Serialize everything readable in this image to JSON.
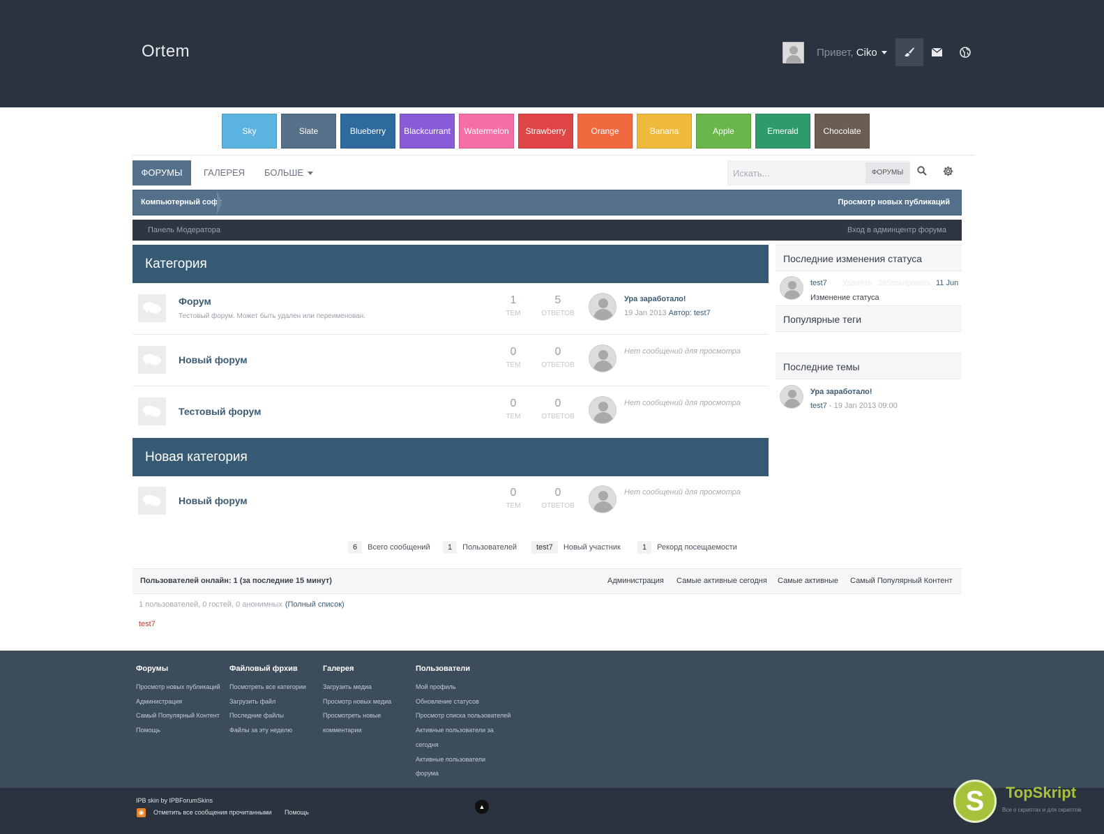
{
  "header": {
    "logo": "Ortem",
    "greeting": "Привет,",
    "username": "Ciko"
  },
  "swatches": [
    {
      "label": "Sky",
      "color": "#5bb4e0"
    },
    {
      "label": "Slate",
      "color": "#56708a"
    },
    {
      "label": "Blueberry",
      "color": "#2f6a9e"
    },
    {
      "label": "Blackcurrant",
      "color": "#8a5bd8"
    },
    {
      "label": "Watermelon",
      "color": "#f56fa6"
    },
    {
      "label": "Strawberry",
      "color": "#e04545"
    },
    {
      "label": "Orange",
      "color": "#f0693f"
    },
    {
      "label": "Banana",
      "color": "#f0bb3c"
    },
    {
      "label": "Apple",
      "color": "#6ab64a"
    },
    {
      "label": "Emerald",
      "color": "#2f9a6b"
    },
    {
      "label": "Chocolate",
      "color": "#6b5d52"
    }
  ],
  "nav": {
    "tabs": [
      "ФОРУМЫ",
      "ГАЛЕРЕЯ",
      "БОЛЬШЕ"
    ],
    "search_placeholder": "Искать...",
    "search_scope": "ФОРУМЫ"
  },
  "breadcrumb": {
    "item": "Компьютерный софт",
    "right": "Просмотр новых публикаций"
  },
  "modbar": {
    "left": "Панель Модератора",
    "right": "Вход в админцентр форума"
  },
  "categories": [
    {
      "title": "Категория",
      "forums": [
        {
          "name": "Форум",
          "desc": "Тестовый форум. Может быть удален или переименован.",
          "topics": "1",
          "replies": "5",
          "topics_label": "ТЕМ",
          "replies_label": "ОТВЕТОВ",
          "last_title": "Ура заработало!",
          "last_date": "19 Jan 2013",
          "last_author_label": "Автор:",
          "last_author": "test7"
        },
        {
          "name": "Новый форум",
          "desc": "",
          "topics": "0",
          "replies": "0",
          "topics_label": "ТЕМ",
          "replies_label": "ОТВЕТОВ",
          "none": "Нет сообщений для просмотра"
        },
        {
          "name": "Тестовый форум",
          "desc": "",
          "topics": "0",
          "replies": "0",
          "topics_label": "ТЕМ",
          "replies_label": "ОТВЕТОВ",
          "none": "Нет сообщений для просмотра"
        }
      ]
    },
    {
      "title": "Новая категория",
      "forums": [
        {
          "name": "Новый форум",
          "desc": "",
          "topics": "0",
          "replies": "0",
          "topics_label": "ТЕМ",
          "replies_label": "ОТВЕТОВ",
          "none": "Нет сообщений для просмотра"
        }
      ]
    }
  ],
  "sidebar": {
    "status_title": "Последние изменения статуса",
    "status_user": "test7",
    "status_delete": "Удалить",
    "status_block": "Заблокировать",
    "status_date": "11 Jun",
    "status_text": "Изменение статуса",
    "tags_title": "Популярные теги",
    "topics_title": "Последние темы",
    "topic_name": "Ура заработало!",
    "topic_user": "test7",
    "topic_meta": " - 19 Jan 2013 09:00"
  },
  "stats": [
    {
      "num": "6",
      "label": "Всего сообщений"
    },
    {
      "num": "1",
      "label": "Пользователей"
    },
    {
      "num": "test7",
      "label": "Новый участник"
    },
    {
      "num": "1",
      "label": "Рекорд посещаемости"
    }
  ],
  "online": {
    "title": "Пользователей онлайн: 1 (за последние 15 минут)",
    "links": [
      "Администрация",
      "Самые активные сегодня",
      "Самые активные",
      "Самый Популярный Контент"
    ],
    "info": "1 пользователей, 0 гостей, 0 анонимных",
    "full_list": "(Полный список)",
    "user": "test7"
  },
  "footer": {
    "columns": [
      {
        "title": "Форумы",
        "links": [
          "Просмотр новых публикаций",
          "Администрация",
          "Самый Популярный Контент",
          "Помощь"
        ]
      },
      {
        "title": "Файловый фрхив",
        "links": [
          "Посмотреть все категории",
          "Загрузить файл",
          "Последние файлы",
          "Файлы за эту неделю"
        ]
      },
      {
        "title": "Галерея",
        "links": [
          "Загрузить медиа",
          "Просмотр новых медиа",
          "Просмотреть новые",
          "комментарии"
        ]
      },
      {
        "title": "Пользователи",
        "links": [
          "Мой профиль",
          "Обновление статусов",
          "Просмотр списка пользователей",
          "Активные пользователи за",
          "сегодня",
          "Активные пользователи",
          "форума"
        ]
      }
    ],
    "credit": "IPB skin by IPBForumSkins",
    "mark_read": "Отметить все сообщения прочитанными",
    "help": "Помощь"
  },
  "watermark": {
    "letter": "S",
    "name": "TopSkript",
    "sub": "Все о скриптах и для скриптов"
  }
}
